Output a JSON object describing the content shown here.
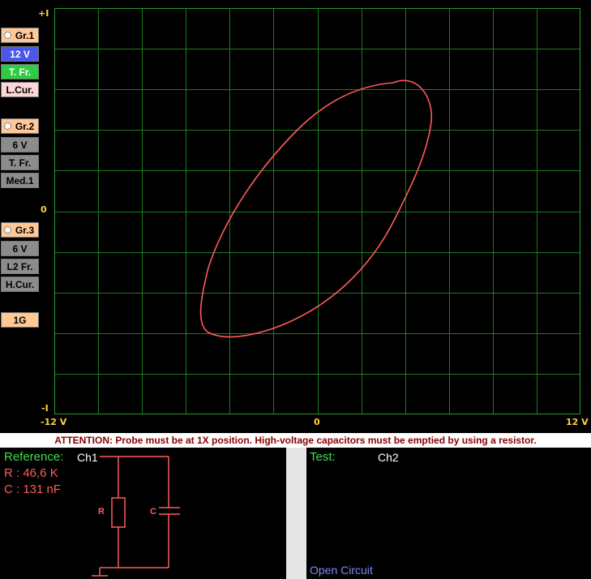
{
  "groups": [
    {
      "name": "Gr.1",
      "voltage": "12 V",
      "freq": "T. Fr.",
      "current": "L.Cur."
    },
    {
      "name": "Gr.2",
      "voltage": "6 V",
      "freq": "T. Fr.",
      "current": "Med.1"
    },
    {
      "name": "Gr.3",
      "voltage": "6 V",
      "freq": "L2 Fr.",
      "current": "H.Cur."
    }
  ],
  "g_button": "1G",
  "axis": {
    "top": "+I",
    "middle": "0",
    "bottom": "-I",
    "x_left": "-12 V",
    "x_center": "0",
    "x_right": "12 V"
  },
  "attention": "ATTENTION: Probe must be at 1X position. High-voltage capacitors must be emptied by using a resistor.",
  "reference": {
    "label": "Reference:",
    "channel": "Ch1",
    "r_value": "R : 46,6 K",
    "c_value": "C : 131 nF",
    "r_symbol": "R",
    "c_symbol": "C"
  },
  "test": {
    "label": "Test:",
    "channel": "Ch2",
    "status": "Open Circuit"
  },
  "colors": {
    "grid": "#1f7a1f",
    "trace": "#ff5a5a",
    "active_voltage": "#4a58e8",
    "active_freq": "#2ecc40",
    "active_current": "#ffd6d6",
    "group_header": "#ffc896",
    "inactive": "#8c8c8c"
  }
}
